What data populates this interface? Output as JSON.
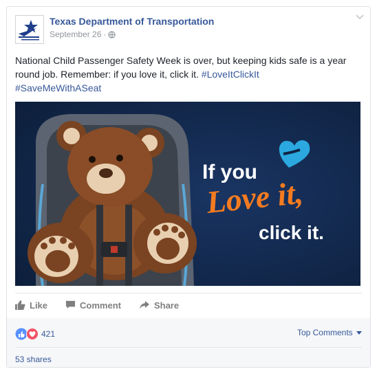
{
  "post": {
    "author": "Texas Department of Transportation",
    "date": "September 26",
    "separator": "·",
    "audience_icon": "globe-icon",
    "text": "National Child Passenger Safety Week is over, but keeping kids safe is a year round job. Remember: if you love it, click it.",
    "hashtags": [
      "#LoveItClickIt",
      "#SaveMeWithASeat"
    ]
  },
  "image": {
    "line1": "If you",
    "line2": "Love it,",
    "line3": "click it.",
    "colors": {
      "background": "#0f2442",
      "accent_orange": "#f47b20",
      "accent_blue": "#2ba8e0"
    }
  },
  "actions": {
    "like": "Like",
    "comment": "Comment",
    "share": "Share"
  },
  "footer": {
    "reaction_count": "421",
    "top_comments": "Top Comments",
    "shares": "53 shares"
  },
  "colors": {
    "link": "#365899",
    "text": "#1d2129",
    "muted": "#90949c",
    "like_blue": "#5890ff",
    "love_red": "#f25268"
  }
}
